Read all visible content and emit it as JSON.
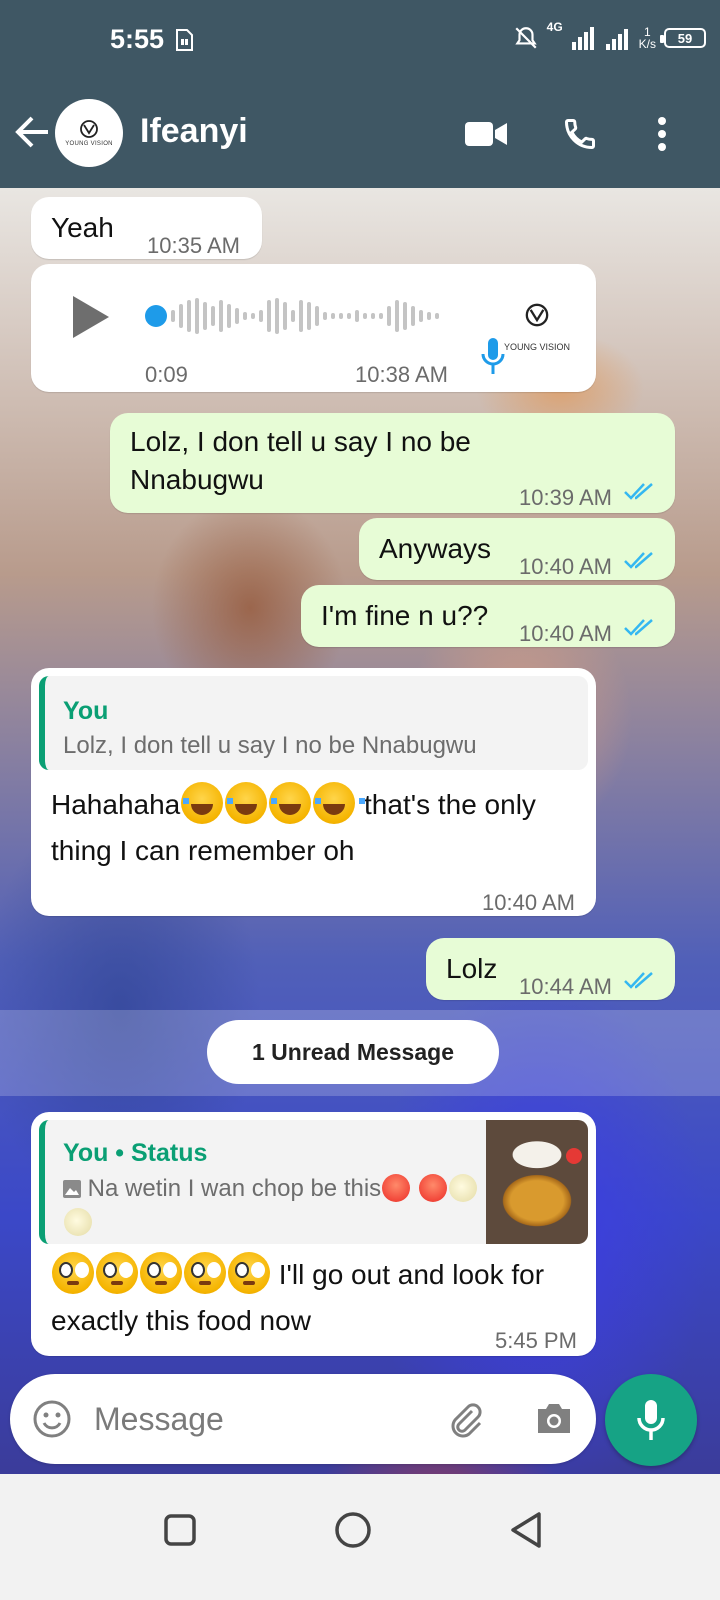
{
  "status_bar": {
    "time": "5:55",
    "network": "4G",
    "speed_value": "1",
    "speed_unit": "K/s",
    "battery": "59"
  },
  "header": {
    "contact_name": "Ifeanyi",
    "avatar_text": "YOUNG VISION"
  },
  "messages": {
    "m1": {
      "text": "Yeah",
      "time": "10:35 AM"
    },
    "voice": {
      "duration": "0:09",
      "time": "10:38 AM",
      "avatar_text": "YOUNG VISION"
    },
    "m2": {
      "text": "Lolz, I don tell u say I no be Nnabugwu",
      "time": "10:39 AM"
    },
    "m3": {
      "text": "Anyways",
      "time": "10:40 AM"
    },
    "m4": {
      "text": "I'm fine n u??",
      "time": "10:40 AM"
    },
    "m5": {
      "quote_author": "You",
      "quote_text": "Lolz, I don tell u say I no be Nnabugwu",
      "text_before": "Hahahaha",
      "text_after": " that's the only thing I can remember oh",
      "time": "10:40 AM"
    },
    "m6": {
      "text": "Lolz",
      "time": "10:44 AM"
    },
    "unread": "1 Unread Message",
    "m7": {
      "quote_author": "You • Status",
      "quote_text": "Na wetin I wan chop be this",
      "text": " I'll go out and look for exactly this food now",
      "time": "5:45 PM"
    }
  },
  "input": {
    "placeholder": "Message"
  },
  "colors": {
    "header": "#3f5764",
    "outgoing_bubble": "#e7fcd6",
    "incoming_bubble": "#ffffff",
    "accent_green": "#0a9f74",
    "fab": "#16a385",
    "read_ticks": "#34b7f1"
  }
}
